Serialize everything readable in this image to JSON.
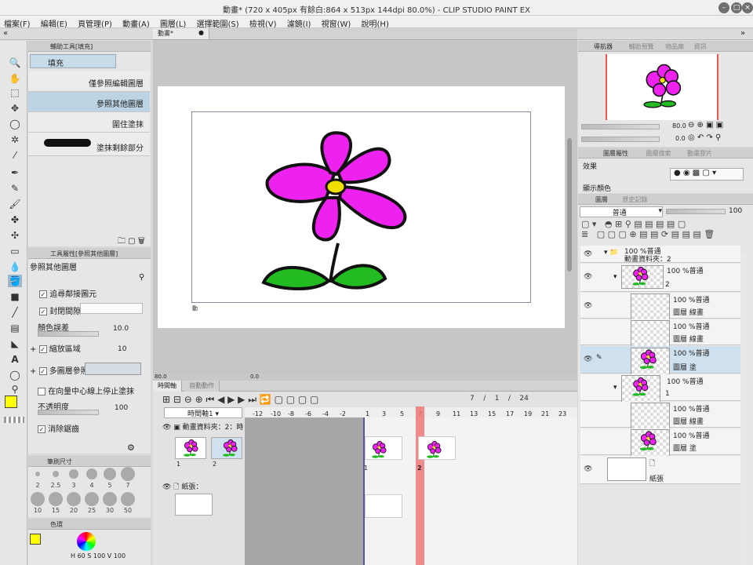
{
  "window": {
    "title": "動畫* (720 x 405px 有餘白:864 x 513px 144dpi 80.0%) - CLIP STUDIO PAINT EX"
  },
  "menu": [
    "檔案(F)",
    "編輯(E)",
    "頁管理(P)",
    "動畫(A)",
    "圖層(L)",
    "選擇範圍(S)",
    "檢視(V)",
    "濾鏡(I)",
    "視窗(W)",
    "說明(H)"
  ],
  "subtool": {
    "tab": "輔助工具[填充]",
    "group": "填充",
    "items": [
      "僅參照編輯圖層",
      "參照其他圖層",
      "圍住塗抹",
      "塗抹剩餘部分"
    ],
    "selected": 1
  },
  "toolprops": {
    "tab": "工具屬性[參照其他圖層]",
    "title": "參照其他圖層",
    "gap": "追尋鄰接圖元",
    "close_gap": "封閉間隙",
    "tolerance_label": "顏色誤差",
    "tolerance": "10.0",
    "expand_label": "縮放區域",
    "expand": "10",
    "multi": "多圖層參照",
    "stop": "在向量中心線上停止塗抹",
    "opacity_label": "不透明度",
    "opacity": "100",
    "antialias": "消除鋸齒"
  },
  "brushsize": {
    "tab": "筆刷尺寸",
    "sizes": [
      "2",
      "2.5",
      "3",
      "4",
      "5",
      "7",
      "10",
      "15",
      "20",
      "25",
      "30",
      "50"
    ]
  },
  "color": {
    "tab": "色環",
    "h": "60",
    "s": "100",
    "v": "100",
    "main": "#ffff00"
  },
  "canvas": {
    "tab": "動畫*",
    "zoom": "80.0",
    "rotation": "0.0",
    "frame_label": "動"
  },
  "timeline": {
    "tab1": "時間軸",
    "tab2": "自動動作",
    "name": "時間軸1",
    "ruler_neg": [
      "-12",
      "-10",
      "-8",
      "-6",
      "-4",
      "-2"
    ],
    "ruler_pos": [
      "1",
      "3",
      "5",
      "7",
      "9",
      "11",
      "13",
      "15",
      "17",
      "19",
      "21",
      "23"
    ],
    "track1": "動畫資料夾：2：時",
    "track2": "紙張：",
    "cells": [
      "1",
      "2"
    ],
    "marker1": "1",
    "marker2": "2",
    "frame": "7",
    "frame_sep": "/",
    "frame_start": "1",
    "frame_end": "24"
  },
  "navigator": {
    "tabs": [
      "導航器",
      "輔助預覽",
      "物品庫",
      "資訊"
    ],
    "zoom": "80.0",
    "angle": "0.0"
  },
  "layerprop": {
    "tabs": [
      "圖層屬性",
      "圖層搜索",
      "動畫膠片"
    ],
    "effect": "效果",
    "display": "顯示顏色"
  },
  "layers": {
    "tabs": [
      "圖層",
      "歷史記錄"
    ],
    "blend": "普通",
    "opacity": "100",
    "rows": [
      {
        "opacity": "100 %普通",
        "name": "動畫資料夾：2"
      },
      {
        "opacity": "100 %普通",
        "name": "2"
      },
      {
        "opacity": "100 %普通",
        "name": "圖層 線畫"
      },
      {
        "opacity": "100 %普通",
        "name": "圖層 線畫"
      },
      {
        "opacity": "100 %普通",
        "name": "圖層 塗"
      },
      {
        "opacity": "100 %普通",
        "name": "1"
      },
      {
        "opacity": "100 %普通",
        "name": "圖層 線畫"
      },
      {
        "opacity": "100 %普通",
        "name": "圖層 塗"
      },
      {
        "opacity": "",
        "name": "紙張"
      }
    ]
  },
  "colors": {
    "accent": "#bcd3e3",
    "flower": "#ee22ee",
    "leaf": "#22bb22",
    "center": "#f0e000",
    "playhead": "#ee7777"
  }
}
